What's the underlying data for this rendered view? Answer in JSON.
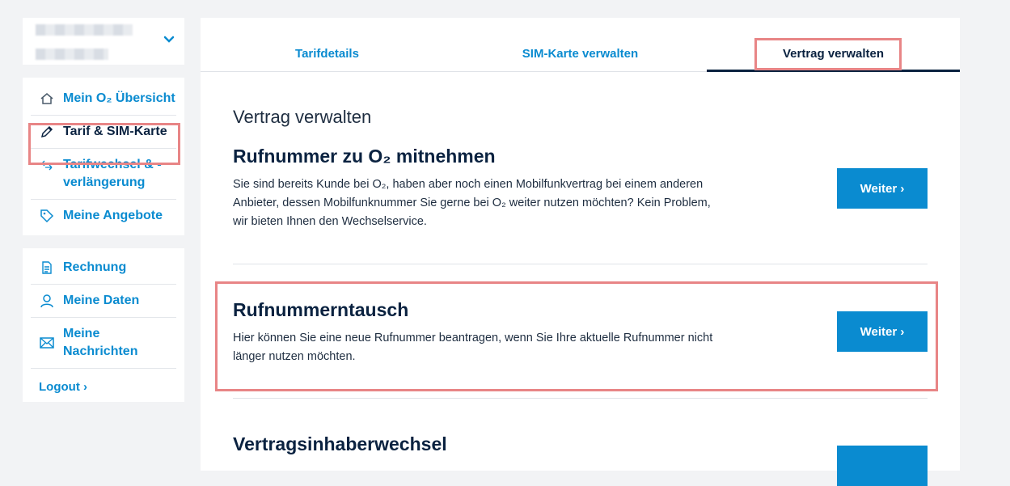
{
  "sidebar": {
    "group1": [
      {
        "label": "Mein O₂ Übersicht",
        "icon": "home-icon"
      },
      {
        "label": "Tarif & SIM-Karte",
        "icon": "pencil-icon"
      },
      {
        "label": "Tarifwechsel & -verlängerung",
        "icon": "swap-icon"
      },
      {
        "label": "Meine Angebote",
        "icon": "tag-icon"
      }
    ],
    "group2": [
      {
        "label": "Rechnung",
        "icon": "document-icon"
      },
      {
        "label": "Meine Daten",
        "icon": "user-icon"
      },
      {
        "label": "Meine Nachrichten",
        "icon": "mail-icon"
      }
    ],
    "logout": "Logout ›"
  },
  "tabs": [
    "Tarifdetails",
    "SIM-Karte verwalten",
    "Vertrag verwalten"
  ],
  "page_title": "Vertrag verwalten",
  "sections": [
    {
      "title": "Rufnummer zu O₂ mitnehmen",
      "text": "Sie sind bereits Kunde bei O₂, haben aber noch einen Mobilfunkvertrag bei einem anderen Anbieter, dessen Mobilfunknummer Sie gerne bei O₂ weiter nutzen möchten? Kein Problem, wir bieten Ihnen den Wechselservice.",
      "button": "Weiter ›"
    },
    {
      "title": "Rufnummerntausch",
      "text": "Hier können Sie eine neue Rufnummer beantragen, wenn Sie Ihre aktuelle Rufnummer nicht länger nutzen möchten.",
      "button": "Weiter ›"
    },
    {
      "title": "Vertragsinhaberwechsel",
      "text": "",
      "button": ""
    }
  ],
  "colors": {
    "brand": "#0a8bd0",
    "navy": "#0a2240",
    "highlight": "#e88586"
  }
}
